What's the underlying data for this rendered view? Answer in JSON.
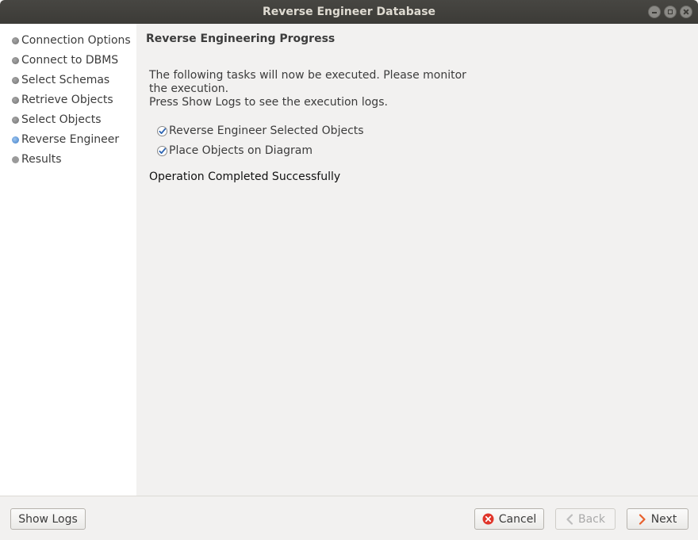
{
  "window": {
    "title": "Reverse Engineer Database"
  },
  "sidebar": {
    "steps": [
      {
        "label": "Connection Options",
        "state": "done"
      },
      {
        "label": "Connect to DBMS",
        "state": "done"
      },
      {
        "label": "Select Schemas",
        "state": "done"
      },
      {
        "label": "Retrieve Objects",
        "state": "done"
      },
      {
        "label": "Select Objects",
        "state": "done"
      },
      {
        "label": "Reverse Engineer",
        "state": "current"
      },
      {
        "label": "Results",
        "state": "pending"
      }
    ]
  },
  "main": {
    "heading": "Reverse Engineering Progress",
    "description": [
      "The following tasks will now be executed. Please monitor",
      "the execution.",
      "Press Show Logs to see the execution logs."
    ],
    "tasks": [
      {
        "label": "Reverse Engineer Selected Objects",
        "checked": true
      },
      {
        "label": "Place Objects on Diagram",
        "checked": true
      }
    ],
    "status": "Operation Completed Successfully"
  },
  "footer": {
    "show_logs": "Show Logs",
    "cancel": "Cancel",
    "back": "Back",
    "next": "Next"
  },
  "colors": {
    "titlebar": "#3c3b37",
    "accent": "#3d7cc7",
    "cancel_icon": "#e0362b",
    "next_icon": "#e8602c"
  }
}
